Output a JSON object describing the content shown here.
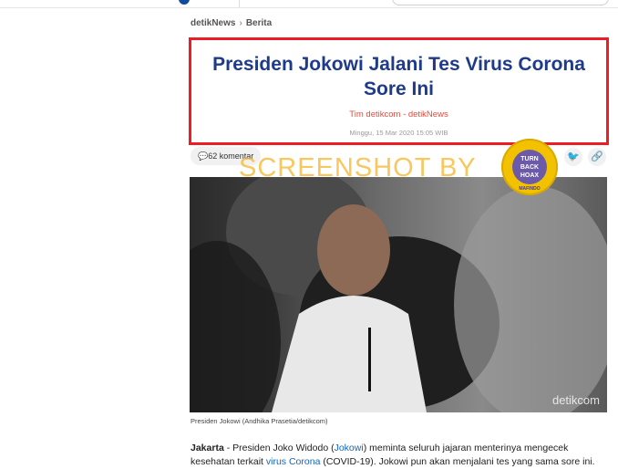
{
  "breadcrumb": {
    "site": "detikNews",
    "section": "Berita"
  },
  "article": {
    "title": "Presiden Jokowi Jalani Tes Virus Corona Sore Ini",
    "author": "Tim detikcom - detikNews",
    "date": "Minggu, 15 Mar 2020 15:05 WIB",
    "comments": "62 komentar",
    "photo_brand": "detikcom",
    "photo_caption": "Presiden Jokowi (Andhika Prasetia/detikcom)",
    "body": {
      "lead": "Jakarta",
      "part1": " - Presiden Joko Widodo (",
      "link1": "Jokowi",
      "part2": ") meminta seluruh jajaran menterinya mengecek kesehatan terkait ",
      "link2": "virus Corona",
      "part3": " (COVID-19). Jokowi pun akan menjalani tes yang sama sore ini."
    }
  },
  "overlay": {
    "watermark": "SCREENSHOT BY",
    "seal_text_1": "TURN",
    "seal_text_2": "BACK",
    "seal_text_3": "HOAX",
    "seal_ring": "MAFINDO"
  },
  "icons": {
    "comment": "comment-icon",
    "twitter": "twitter-icon",
    "link": "link-icon"
  },
  "colors": {
    "title": "#1e3a8a",
    "highlight_border": "#ee1c25",
    "author": "#e8483c",
    "link": "#1565c0"
  }
}
